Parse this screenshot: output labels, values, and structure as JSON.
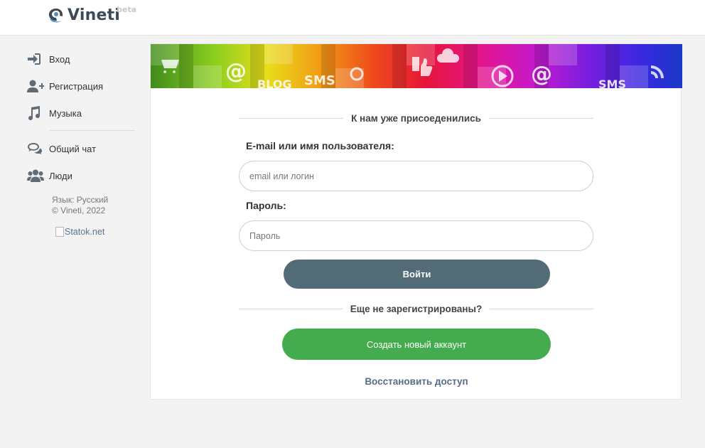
{
  "header": {
    "logo_text": "Vineti",
    "logo_badge": "beta",
    "logo_color": "#3c4a56"
  },
  "sidebar": {
    "items": [
      {
        "label": "Вход",
        "icon": "sign-in-icon"
      },
      {
        "label": "Регистрация",
        "icon": "user-plus-icon"
      },
      {
        "label": "Музыка",
        "icon": "music-note-icon"
      },
      {
        "label": "Общий чат",
        "icon": "chat-bubbles-icon"
      },
      {
        "label": "Люди",
        "icon": "users-icon"
      }
    ],
    "language": "Язык: Русский",
    "copyright": "© Vineti, 2022",
    "counter_alt": "Statok.net"
  },
  "login": {
    "joined_heading": "К нам уже присоеденились",
    "username_label": "E-mail или имя пользователя:",
    "username_placeholder": "email или логин",
    "password_label": "Пароль:",
    "password_placeholder": "Пароль",
    "submit_label": "Войти",
    "register_heading": "Еще не зарегистрированы?",
    "create_account_label": "Создать новый аккаунт",
    "restore_label": "Восстановить доступ"
  },
  "banner": {
    "tiles": [
      "@",
      "BLOG",
      "SMS",
      "@",
      "SMS"
    ]
  },
  "colors": {
    "login_button": "#526b77",
    "create_button": "#44ab4e",
    "link": "#566d85",
    "page_bg": "#f3f3f3"
  }
}
